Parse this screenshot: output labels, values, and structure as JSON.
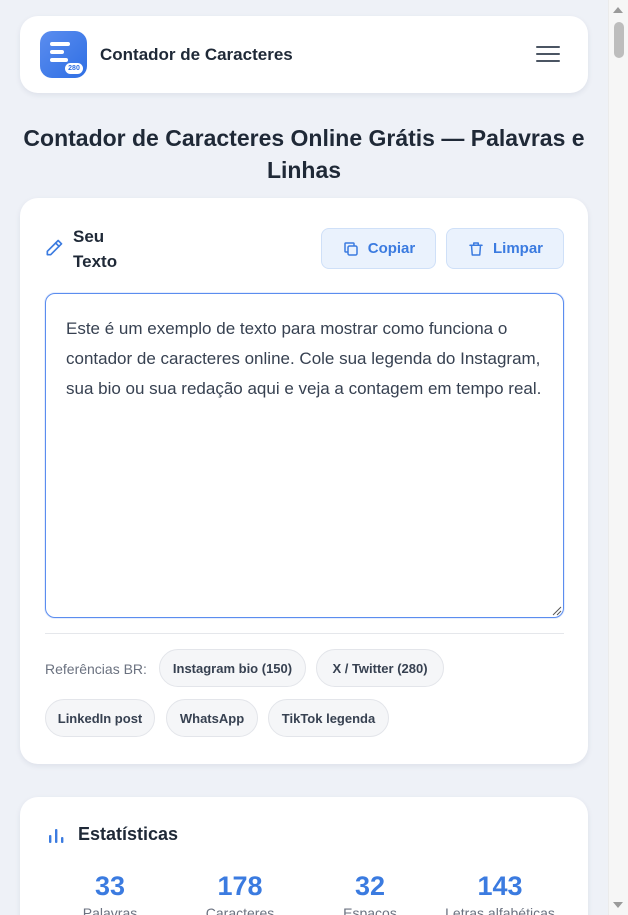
{
  "header": {
    "logo_badge": "280",
    "app_title": "Contador de Caracteres",
    "menu_icon": "hamburger-icon"
  },
  "page_title": "Contador de Caracteres Online Grátis — Palavras e Linhas",
  "editor": {
    "label_line1": "Seu",
    "label_line2": "Texto",
    "label_icon": "pencil-icon",
    "copy_label": "Copiar",
    "copy_icon": "copy-icon",
    "clear_label": "Limpar",
    "clear_icon": "trash-icon",
    "text_value": "Este é um exemplo de texto para mostrar como funciona o contador de caracteres online. Cole sua legenda do Instagram, sua bio ou sua redação aqui e veja a contagem em tempo real.",
    "references_label": "Referências BR:",
    "references": [
      "Instagram bio (150)",
      "X / Twitter (280)",
      "LinkedIn post",
      "WhatsApp",
      "TikTok legenda"
    ]
  },
  "stats": {
    "title": "Estatísticas",
    "icon": "bar-chart-icon",
    "items": [
      {
        "value": "33",
        "label": "Palavras"
      },
      {
        "value": "178",
        "label": "Caracteres"
      },
      {
        "value": "32",
        "label": "Espaços"
      },
      {
        "value": "143",
        "label": "Letras alfabéticas"
      }
    ]
  },
  "colors": {
    "accent": "#3b7be0",
    "background": "#eef1f7",
    "card": "#ffffff"
  }
}
